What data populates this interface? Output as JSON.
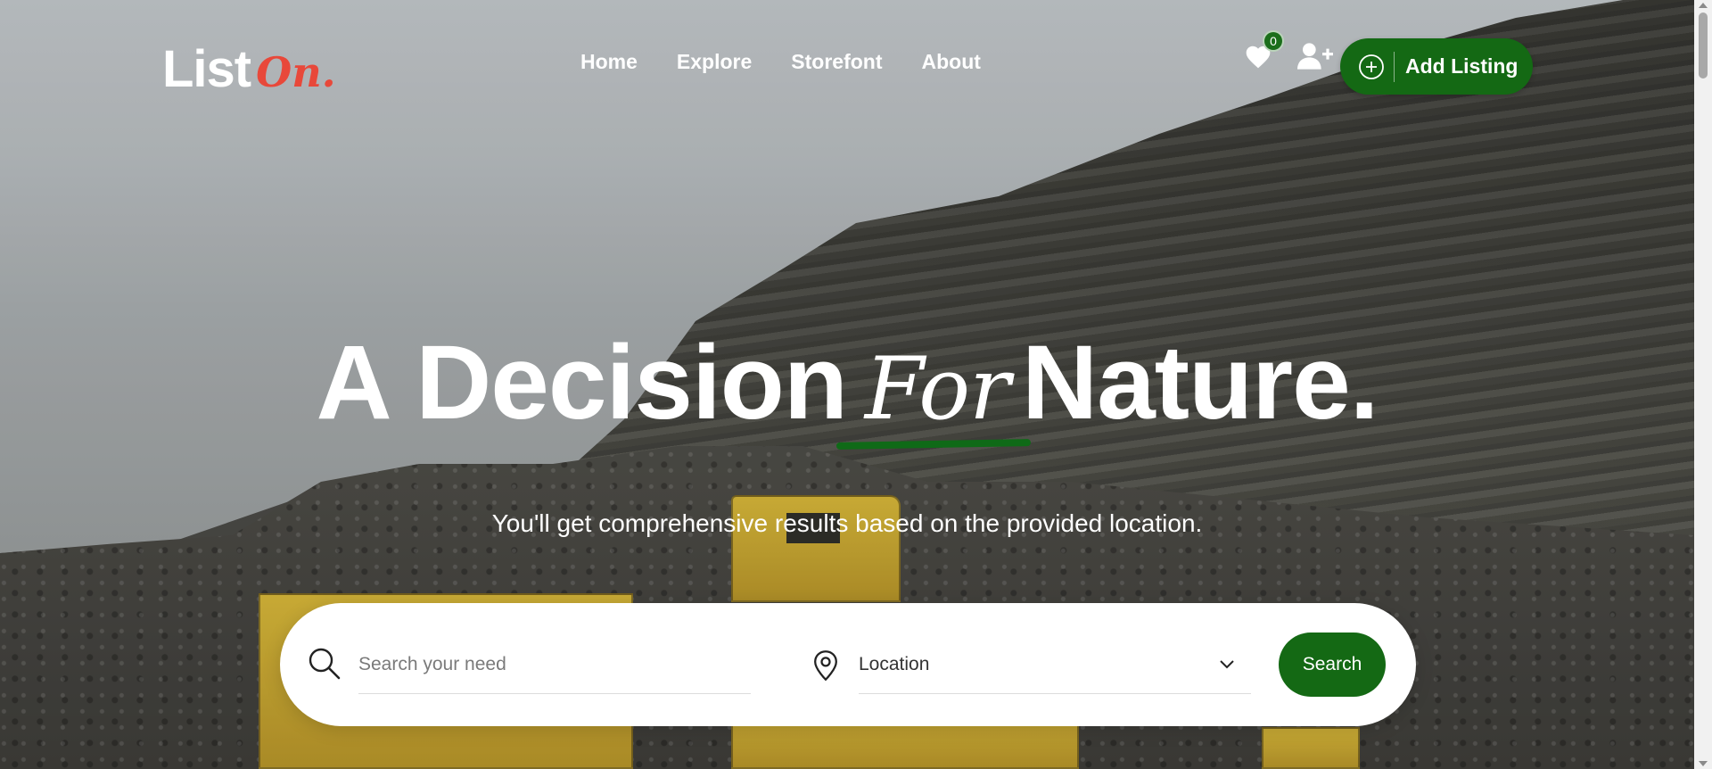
{
  "brand": {
    "logo_main": "List",
    "logo_accent": "On."
  },
  "nav": {
    "items": [
      {
        "label": "Home"
      },
      {
        "label": "Explore"
      },
      {
        "label": "Storefont"
      },
      {
        "label": "About"
      }
    ]
  },
  "header_actions": {
    "wishlist_icon": "heart-icon",
    "wishlist_count": "0",
    "account_icon": "user-plus-icon",
    "add_listing_icon": "plus-circle-icon",
    "add_listing_label": "Add Listing"
  },
  "hero": {
    "title_before": "A Decision",
    "title_accent": "For",
    "title_after": "Nature.",
    "subtitle": "You'll get comprehensive results based on the provided location."
  },
  "search": {
    "search_icon": "search-icon",
    "query_value": "",
    "query_placeholder": "Search your need",
    "location_icon": "map-pin-icon",
    "location_value": "Location",
    "dropdown_icon": "chevron-down-icon",
    "button_label": "Search"
  },
  "colors": {
    "accent_green": "#146914",
    "logo_red": "#e8483a",
    "white": "#ffffff"
  }
}
